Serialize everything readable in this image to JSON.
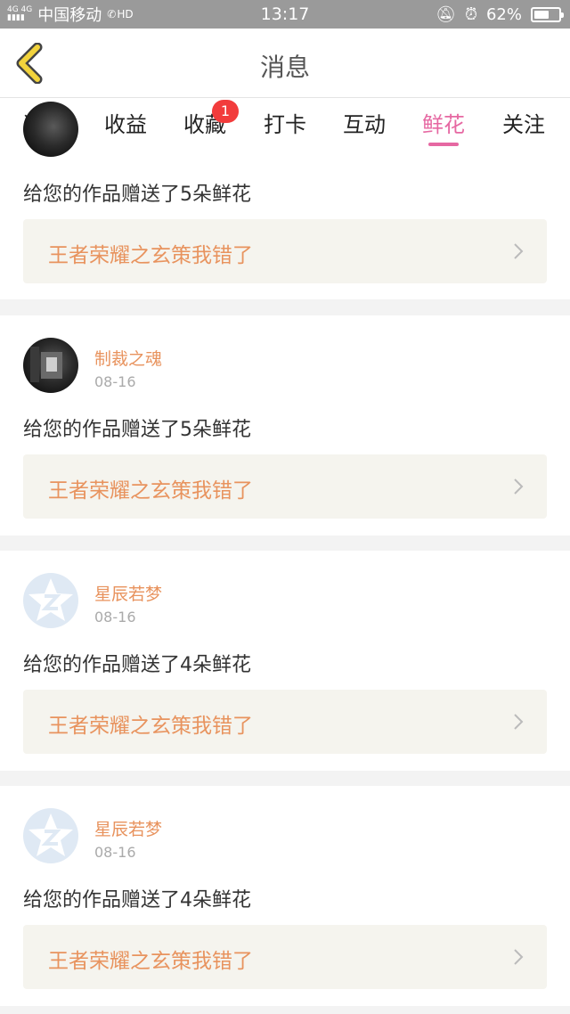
{
  "status_bar": {
    "network_top": "4G 4G",
    "carrier": "中国移动",
    "hd": "HD",
    "time": "13:17",
    "battery": "62%",
    "battery_level": 0.62
  },
  "header": {
    "title": "消息"
  },
  "tabs": [
    {
      "label": "通知"
    },
    {
      "label": "收益"
    },
    {
      "label": "收藏",
      "badge": "1"
    },
    {
      "label": "打卡"
    },
    {
      "label": "互动"
    },
    {
      "label": "鲜花",
      "active": true
    },
    {
      "label": "关注"
    }
  ],
  "messages": [
    {
      "text": "给您的作品赠送了5朵鲜花",
      "work": "王者荣耀之玄策我错了"
    },
    {
      "user": "制裁之魂",
      "date": "08-16",
      "text": "给您的作品赠送了5朵鲜花",
      "work": "王者荣耀之玄策我错了"
    },
    {
      "user": "星辰若梦",
      "date": "08-16",
      "text": "给您的作品赠送了4朵鲜花",
      "work": "王者荣耀之玄策我错了"
    },
    {
      "user": "星辰若梦",
      "date": "08-16",
      "text": "给您的作品赠送了4朵鲜花",
      "work": "王者荣耀之玄策我错了"
    }
  ],
  "colors": {
    "accent": "#e668a2",
    "username": "#e8935e",
    "badge": "#f23c3c",
    "back_arrow": "#f2d33c"
  }
}
